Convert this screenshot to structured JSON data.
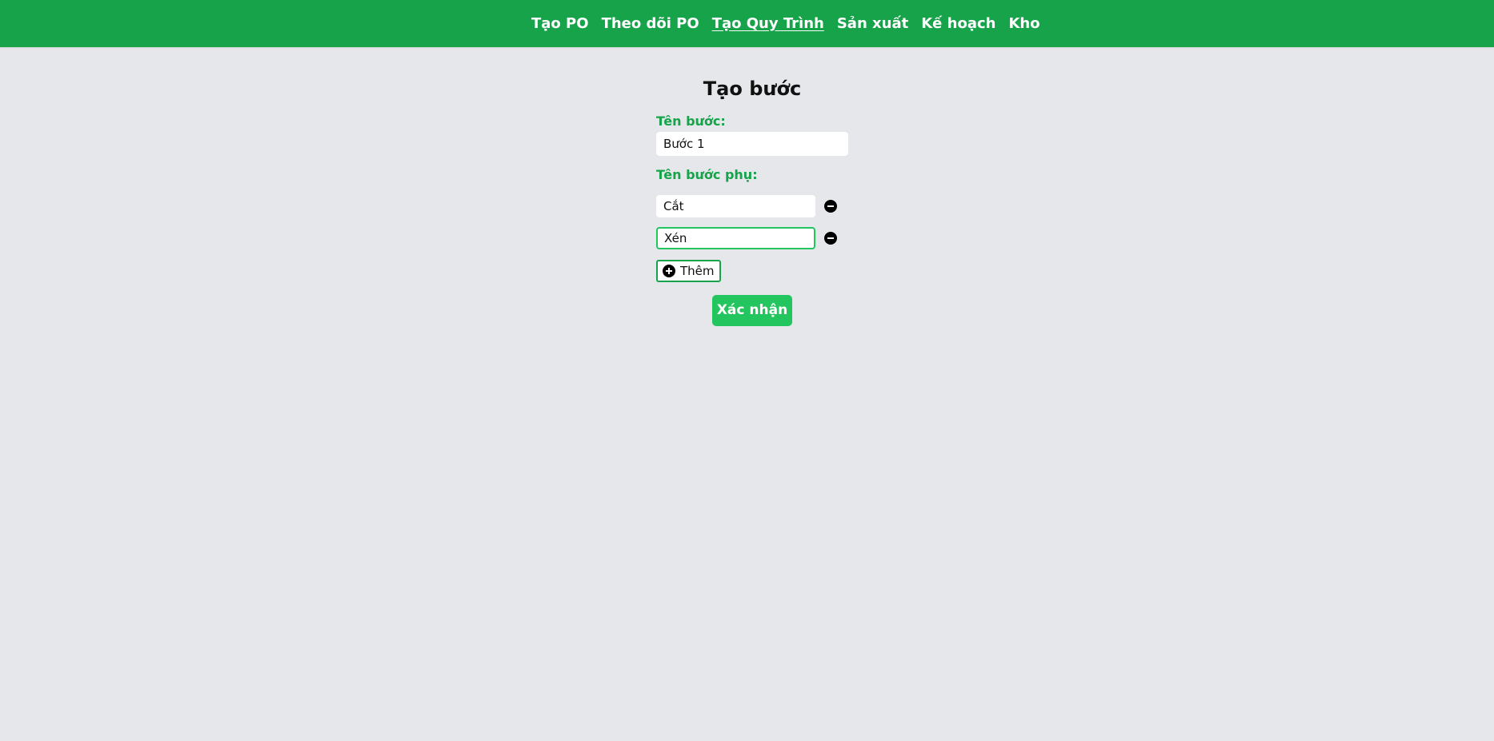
{
  "nav": {
    "items": [
      {
        "label": "Tạo PO",
        "active": false
      },
      {
        "label": "Theo dõi PO",
        "active": false
      },
      {
        "label": "Tạo Quy Trình",
        "active": true
      },
      {
        "label": "Sản xuất",
        "active": false
      },
      {
        "label": "Kế hoạch",
        "active": false
      },
      {
        "label": "Kho",
        "active": false
      }
    ]
  },
  "form": {
    "title": "Tạo bước",
    "step_name_label": "Tên bước:",
    "step_name_value": "Bước 1",
    "substep_label": "Tên bước phụ:",
    "substeps": [
      {
        "value": "Cắt"
      },
      {
        "value": "Xén"
      }
    ],
    "add_label": "Thêm",
    "submit_label": "Xác nhận"
  },
  "colors": {
    "header_bg": "#16a34a",
    "page_bg": "#e5e7eb",
    "label_green": "#16a34a",
    "submit_bg": "#22c55e"
  }
}
